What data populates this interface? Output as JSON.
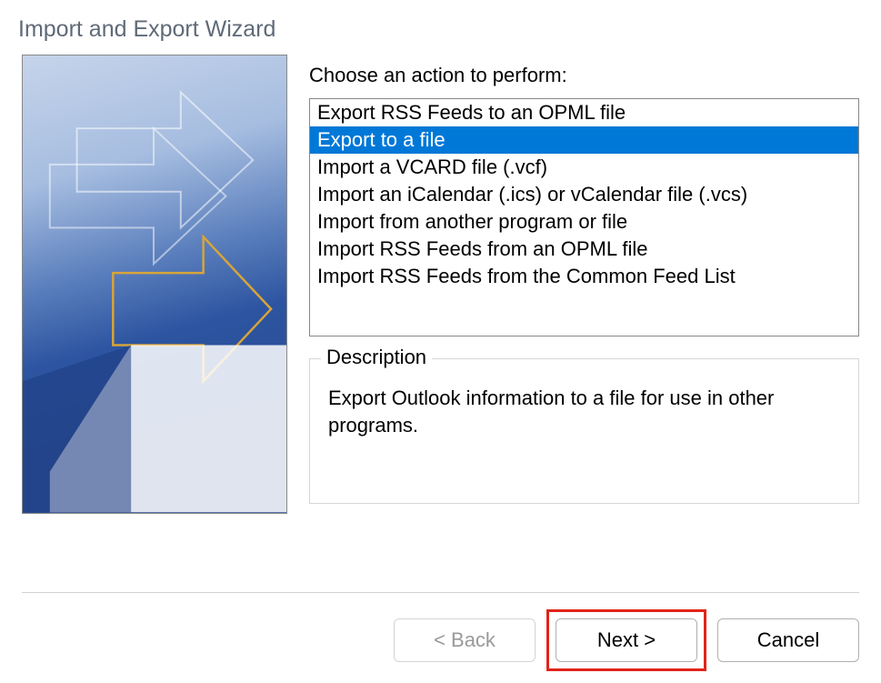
{
  "dialog": {
    "title": "Import and Export Wizard",
    "prompt": "Choose an action to perform:",
    "actions": [
      "Export RSS Feeds to an OPML file",
      "Export to a file",
      "Import a VCARD file (.vcf)",
      "Import an iCalendar (.ics) or vCalendar file (.vcs)",
      "Import from another program or file",
      "Import RSS Feeds from an OPML file",
      "Import RSS Feeds from the Common Feed List"
    ],
    "selected_index": 1,
    "description_label": "Description",
    "description_text": "Export Outlook information to a file for use in other programs.",
    "buttons": {
      "back": "< Back",
      "next": "Next >",
      "cancel": "Cancel"
    }
  }
}
